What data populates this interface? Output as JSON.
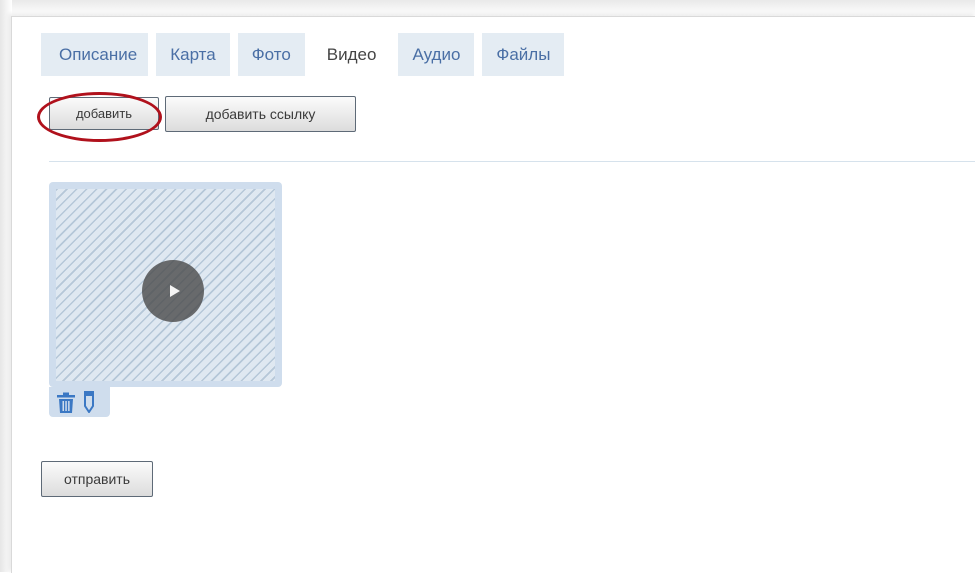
{
  "tabs": [
    {
      "label": "Описание",
      "active": false
    },
    {
      "label": "Карта",
      "active": false
    },
    {
      "label": "Фото",
      "active": false
    },
    {
      "label": "Видео",
      "active": true
    },
    {
      "label": "Аудио",
      "active": false
    },
    {
      "label": "Файлы",
      "active": false
    }
  ],
  "toolbar": {
    "add_label": "добавить",
    "add_link_label": "добавить ссылку"
  },
  "video_item": {
    "thumbnail_icon": "play-icon",
    "actions": [
      "trash-icon",
      "edit-icon"
    ]
  },
  "form": {
    "submit_label": "отправить"
  },
  "colors": {
    "tab_background": "#e4ecf3",
    "tab_text": "#4a6fa5",
    "highlight": "#b0111c",
    "card_background": "#cfdded"
  }
}
